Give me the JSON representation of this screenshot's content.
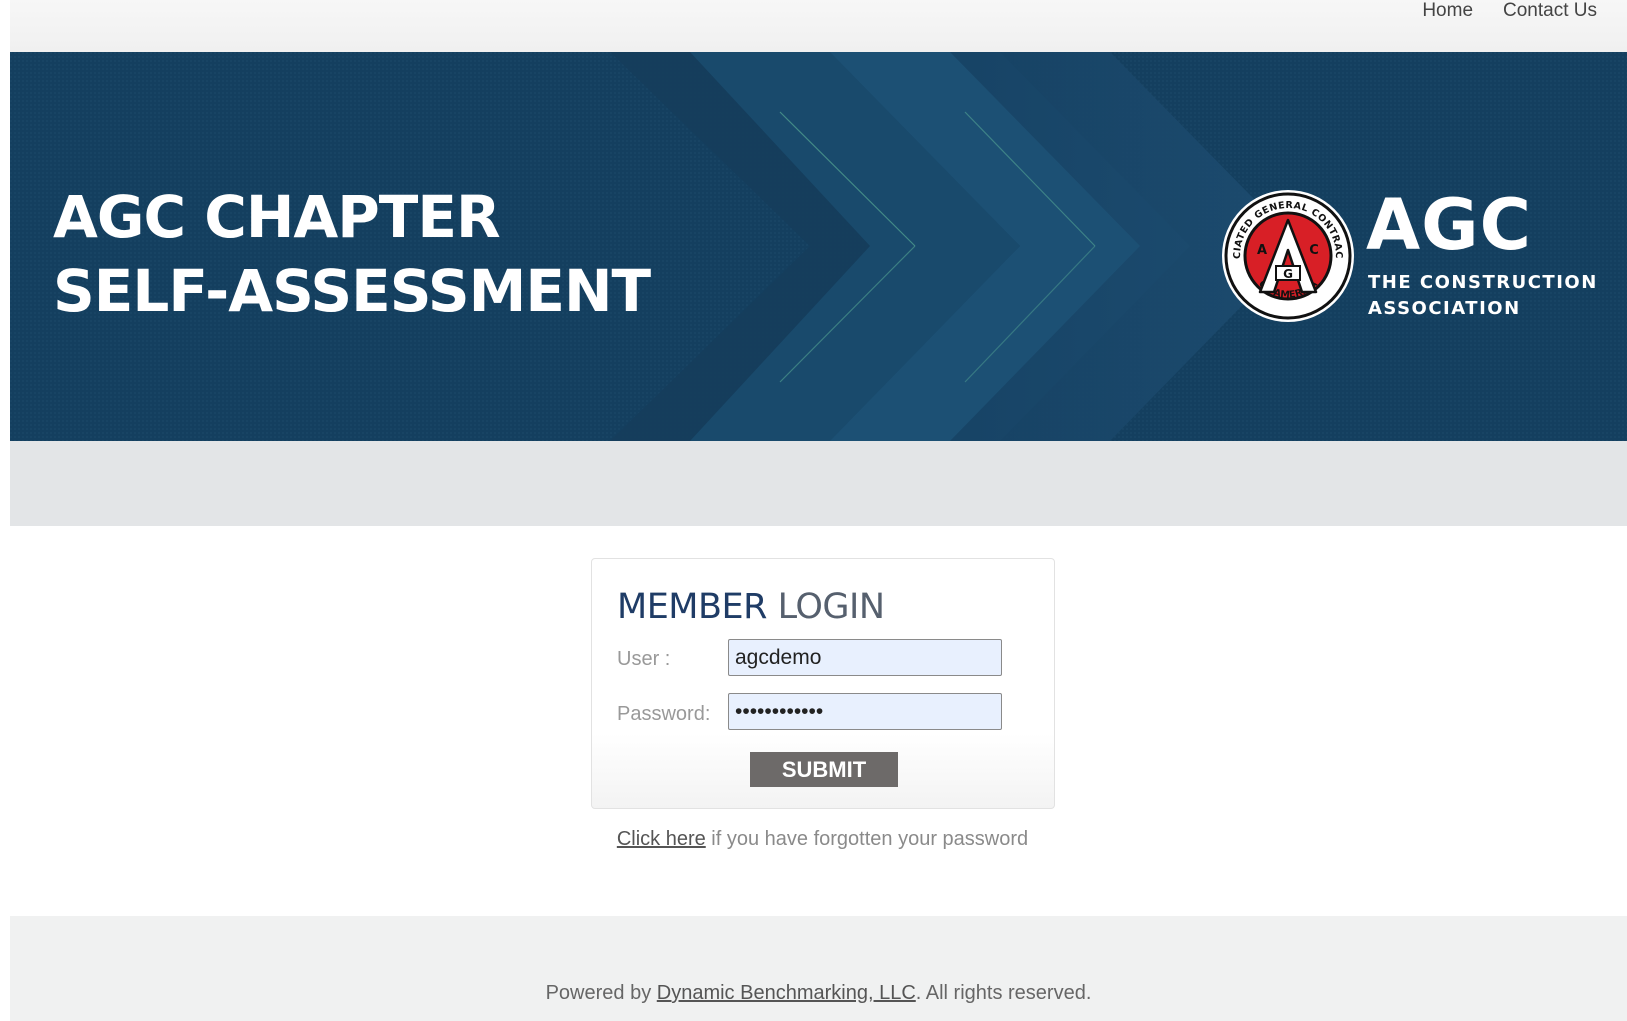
{
  "nav": {
    "home": "Home",
    "contact": "Contact Us"
  },
  "banner": {
    "title_line1": "AGC CHAPTER",
    "title_line2": "SELF-ASSESSMENT",
    "logo_big": "AGC",
    "logo_sub1": "THE CONSTRUCTION",
    "logo_sub2": "ASSOCIATION",
    "seal_text_top": "ASSOCIATED GENERAL CONTRACTORS",
    "seal_text_bottom": "OF AMERICA",
    "seal_letters": [
      "A",
      "G",
      "C"
    ]
  },
  "login": {
    "title_part1": "MEMBER",
    "title_part2": "LOGIN",
    "user_label": "User :",
    "user_value": "agcdemo",
    "password_label": "Password:",
    "password_value": "agcdemo12345",
    "submit_label": "SUBMIT"
  },
  "forgot": {
    "link_text": "Click here",
    "rest_text": " if you have forgotten your password"
  },
  "footer": {
    "prefix": "Powered by ",
    "link_text": "Dynamic Benchmarking, LLC",
    "suffix": ". All rights reserved."
  },
  "colors": {
    "banner_bg": "#143f5f",
    "title_dark_blue": "#1f3c66",
    "seal_red": "#d81f26",
    "submit_bg": "#6d6a69",
    "input_bg": "#e8f0fe"
  }
}
